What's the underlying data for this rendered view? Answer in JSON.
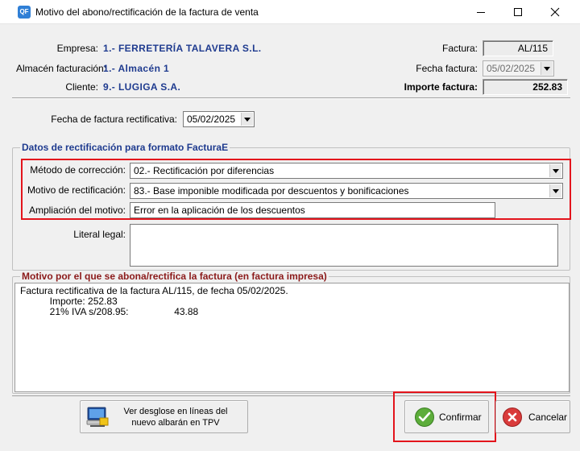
{
  "window": {
    "title": "Motivo del abono/rectificación de la factura de venta",
    "app_icon": "QF",
    "controls": {
      "minimize": "minimize-icon",
      "maximize": "maximize-icon",
      "close": "close-icon"
    }
  },
  "header": {
    "empresa_label": "Empresa:",
    "empresa_value": "1.- FERRETERÍA TALAVERA S.L.",
    "almacen_label": "Almacén facturación:",
    "almacen_value": "1.- Almacén 1",
    "cliente_label": "Cliente:",
    "cliente_value": "9.- LUGIGA S.A.",
    "factura_label": "Factura:",
    "factura_value": "AL/115",
    "fecha_factura_label": "Fecha factura:",
    "fecha_factura_value": "05/02/2025",
    "importe_label": "Importe factura:",
    "importe_value": "252.83"
  },
  "rectificativa": {
    "fecha_label": "Fecha de factura rectificativa:",
    "fecha_value": "05/02/2025"
  },
  "facturae": {
    "group_title": "Datos de rectificación para formato FacturaE",
    "metodo_label": "Método de corrección:",
    "metodo_value": "02.- Rectificación por diferencias",
    "motivo_label": "Motivo de rectificación:",
    "motivo_value": "83.- Base imponible modificada por descuentos y bonificaciones",
    "ampliacion_label": "Ampliación del motivo:",
    "ampliacion_value": "Error en la aplicación de los descuentos",
    "literal_label": "Literal legal:",
    "literal_value": ""
  },
  "motivo_impreso": {
    "group_title": "Motivo por el que se abona/rectifica la factura (en factura impresa)",
    "text": "Factura rectificativa de la factura AL/115, de fecha 05/02/2025.\n           Importe: 252.83\n           21% IVA s/208.95:                 43.88"
  },
  "footer": {
    "desglose_label": "Ver desglose en líneas del nuevo albarán en TPV",
    "confirmar_label": "Confirmar",
    "cancelar_label": "Cancelar"
  },
  "colors": {
    "accent_red": "#e3141c",
    "value_blue": "#1f3b8f",
    "group_title_navy": "#1f3b8f",
    "group_title_maroon": "#8b1a1a"
  }
}
